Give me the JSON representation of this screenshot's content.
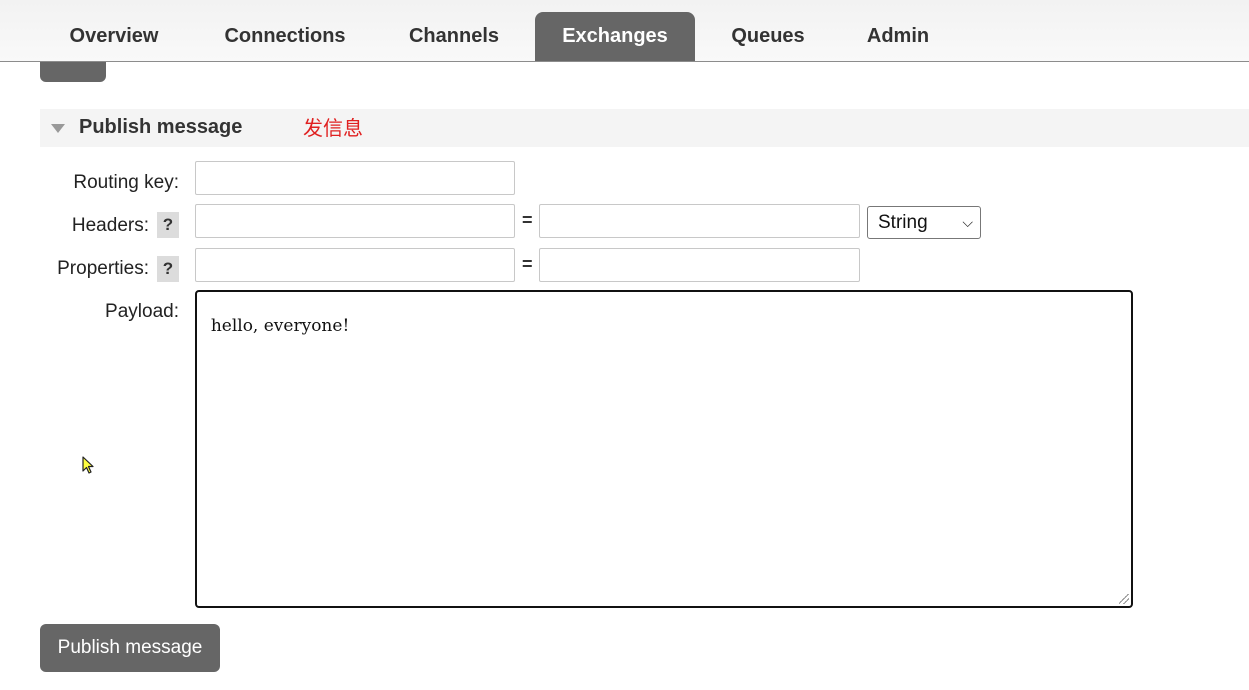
{
  "nav": {
    "tabs": [
      {
        "label": "Overview"
      },
      {
        "label": "Connections"
      },
      {
        "label": "Channels"
      },
      {
        "label": "Exchanges",
        "active": true
      },
      {
        "label": "Queues"
      },
      {
        "label": "Admin"
      }
    ]
  },
  "section": {
    "title": "Publish message",
    "annotation": "发信息"
  },
  "form": {
    "routing_key_label": "Routing key:",
    "routing_key_value": "",
    "headers_label": "Headers:",
    "headers_key_value": "",
    "headers_value_value": "",
    "headers_type_selected": "String",
    "properties_label": "Properties:",
    "properties_key_value": "",
    "properties_value_value": "",
    "help_glyph": "?",
    "equals": "=",
    "payload_label": "Payload:",
    "payload_value": "hello, everyone!"
  },
  "actions": {
    "publish_label": "Publish message"
  },
  "colors": {
    "active_tab": "#666666",
    "annotation": "#e02020",
    "button": "#666666"
  }
}
